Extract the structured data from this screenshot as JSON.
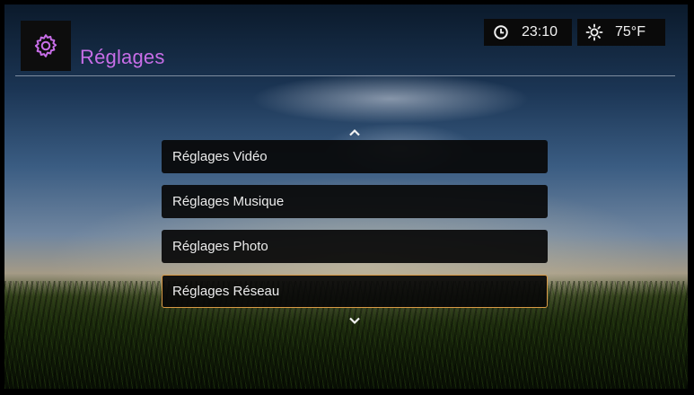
{
  "header": {
    "title": "Réglages",
    "icon": "gear-icon",
    "accent_color": "#c86ee8"
  },
  "status": {
    "time": "23:10",
    "time_icon": "clock-icon",
    "temperature": "75°F",
    "weather_icon": "sun-icon"
  },
  "menu": {
    "scroll_up_icon": "chevron-up-icon",
    "scroll_down_icon": "chevron-down-icon",
    "selected_border_color": "#d99a45",
    "items": [
      {
        "label": "Réglages Vidéo"
      },
      {
        "label": "Réglages Musique"
      },
      {
        "label": "Réglages Photo"
      },
      {
        "label": "Réglages Réseau",
        "selected": true
      }
    ]
  }
}
